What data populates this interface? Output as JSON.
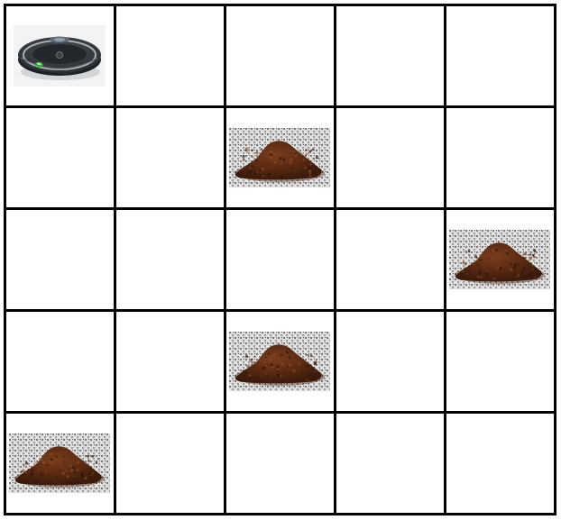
{
  "grid": {
    "rows": 5,
    "cols": 5
  },
  "colors": {
    "line": "#000000",
    "cell_background": "#ffffff",
    "dirt_dark": "#3a1b0c",
    "dirt_mid": "#5a2a12",
    "dirt_light": "#7a3d1c",
    "carpet_base": "#dcdcdc",
    "robot_body": "#2b2f33",
    "robot_ring": "#a9b0b5",
    "robot_light": "#3cd23c"
  },
  "pieces": [
    {
      "type": "robot-vacuum",
      "row": 0,
      "col": 0,
      "icon": "robot-vacuum-icon"
    },
    {
      "type": "dirt",
      "row": 1,
      "col": 2,
      "icon": "dirt-pile-icon"
    },
    {
      "type": "dirt",
      "row": 2,
      "col": 4,
      "icon": "dirt-pile-icon"
    },
    {
      "type": "dirt",
      "row": 3,
      "col": 2,
      "icon": "dirt-pile-icon"
    },
    {
      "type": "dirt",
      "row": 4,
      "col": 0,
      "icon": "dirt-pile-icon"
    }
  ]
}
